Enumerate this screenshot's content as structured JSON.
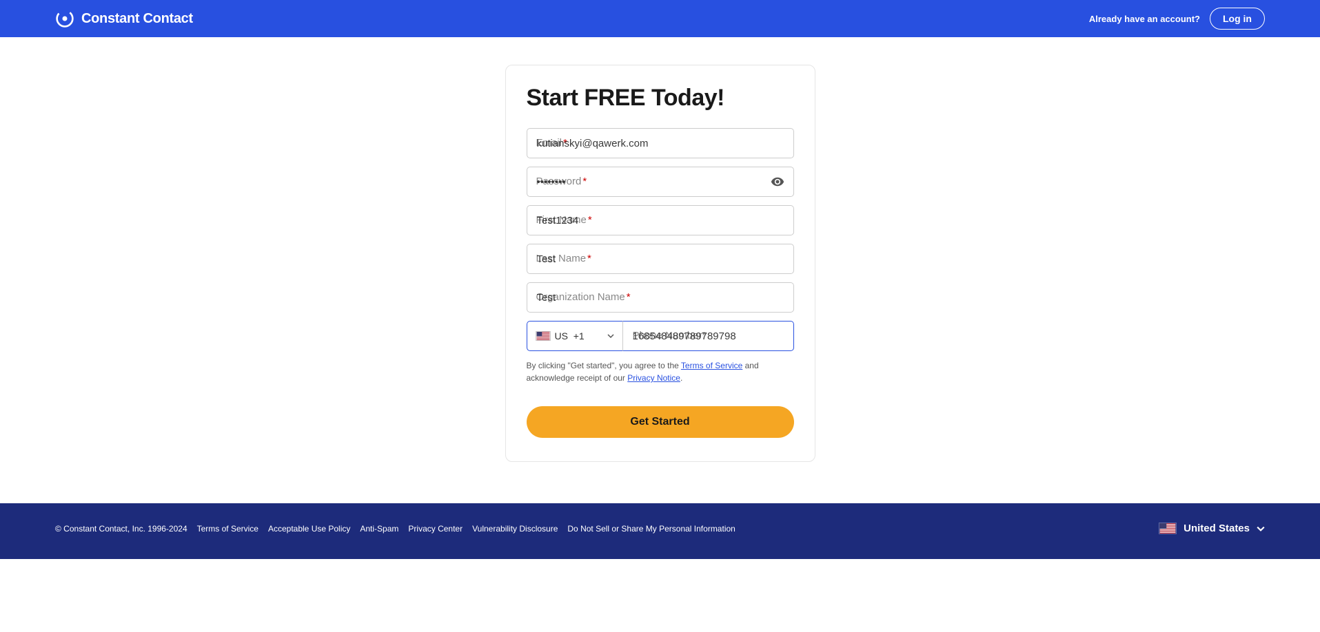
{
  "header": {
    "brand": "Constant Contact",
    "account_text": "Already have an account?",
    "login_label": "Log in"
  },
  "form": {
    "heading": "Start FREE Today!",
    "email": {
      "label": "Email",
      "value": "kutianskyi@qawerk.com"
    },
    "password": {
      "label": "Password",
      "value": "••••••••"
    },
    "first_name": {
      "label": "First Name",
      "value": "Test1234"
    },
    "last_name": {
      "label": "Last Name",
      "value": "Test"
    },
    "org_name": {
      "label": "Organization Name",
      "value": "Test"
    },
    "country": {
      "code": "US",
      "dial": "+1"
    },
    "phone": {
      "label": "Phone Number",
      "value": "168548489789789798"
    },
    "legal": {
      "prefix": "By clicking \"Get started\", you agree to the ",
      "tos": "Terms of Service",
      "mid": " and acknowledge receipt of our ",
      "privacy": "Privacy Notice",
      "suffix": "."
    },
    "cta": "Get Started"
  },
  "footer": {
    "copyright": "© Constant Contact, Inc. 1996-2024",
    "links": [
      "Terms of Service",
      "Acceptable Use Policy",
      "Anti-Spam",
      "Privacy Center",
      "Vulnerability Disclosure",
      "Do Not Sell or Share My Personal Information"
    ],
    "country": "United States"
  }
}
